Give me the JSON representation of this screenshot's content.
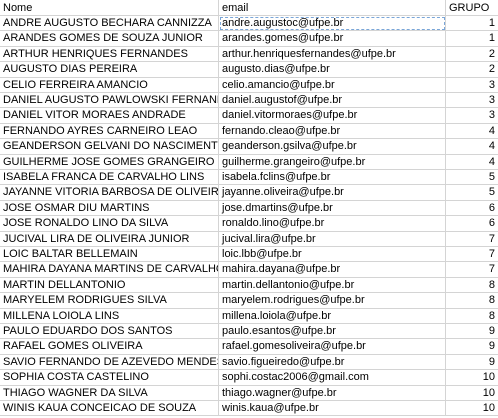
{
  "headers": [
    "Nome",
    "email",
    "GRUPO"
  ],
  "rows": [
    [
      "ANDRE AUGUSTO BECHARA CANNIZZA",
      "andre.augustoc@ufpe.br",
      "1"
    ],
    [
      " ARANDES GOMES DE SOUZA JUNIOR",
      "arandes.gomes@ufpe.br",
      "1"
    ],
    [
      "ARTHUR HENRIQUES FERNANDES",
      "arthur.henriquesfernandes@ufpe.br",
      "2"
    ],
    [
      "AUGUSTO DIAS PEREIRA",
      "augusto.dias@ufpe.br",
      "2"
    ],
    [
      "CELIO FERREIRA AMANCIO",
      "celio.amancio@ufpe.br",
      "3"
    ],
    [
      "DANIEL AUGUSTO PAWLOWSKI FERNANDES",
      "daniel.augustof@ufpe.br",
      "3"
    ],
    [
      " DANIEL VITOR MORAES ANDRADE",
      "daniel.vitormoraes@ufpe.br",
      "3"
    ],
    [
      "FERNANDO AYRES CARNEIRO LEAO",
      "fernando.cleao@ufpe.br",
      "4"
    ],
    [
      "GEANDERSON GELVANI DO NASCIMENTO SILVA",
      "geanderson.gsilva@ufpe.br",
      "4"
    ],
    [
      "GUILHERME JOSE GOMES GRANGEIRO",
      "guilherme.grangeiro@ufpe.br",
      "4"
    ],
    [
      "ISABELA FRANCA DE CARVALHO LINS",
      "isabela.fclins@ufpe.br",
      "5"
    ],
    [
      "JAYANNE VITORIA BARBOSA DE OLIVEIRA",
      "jayanne.oliveira@ufpe.br",
      "5"
    ],
    [
      "JOSE OSMAR DIU MARTINS",
      "jose.dmartins@ufpe.br",
      "6"
    ],
    [
      "JOSE RONALDO LINO DA SILVA",
      "ronaldo.lino@ufpe.br",
      "6"
    ],
    [
      "JUCIVAL LIRA DE OLIVEIRA JUNIOR",
      "jucival.lira@ufpe.br",
      "7"
    ],
    [
      "LOIC BALTAR BELLEMAIN",
      "loic.lbb@ufpe.br",
      "7"
    ],
    [
      "MAHIRA DAYANA MARTINS DE CARVALHO NASCIMENTO",
      "mahira.dayana@ufpe.br",
      "7"
    ],
    [
      "MARTIN DELLANTONIO",
      "martin.dellantonio@ufpe.br",
      "8"
    ],
    [
      "MARYELEM RODRIGUES SILVA",
      "maryelem.rodrigues@ufpe.br",
      "8"
    ],
    [
      "MILLENA LOIOLA LINS",
      "millena.loiola@ufpe.br",
      "8"
    ],
    [
      "PAULO EDUARDO DOS SANTOS",
      "paulo.esantos@ufpe.br",
      "9"
    ],
    [
      "RAFAEL GOMES OLIVEIRA",
      "rafael.gomesoliveira@ufpe.br",
      "9"
    ],
    [
      "SAVIO FERNANDO DE AZEVEDO MENDES FIGUEIREDO",
      "savio.figueiredo@ufpe.br",
      "9"
    ],
    [
      "SOPHIA COSTA CASTELINO",
      "sophi.costac2006@gmail.com",
      "10"
    ],
    [
      "THIAGO WAGNER DA SILVA",
      "thiago.wagner@ufpe.br",
      "10"
    ],
    [
      "WINIS KAUA CONCEICAO DE SOUZA",
      "winis.kaua@ufpe.br",
      "10"
    ]
  ]
}
